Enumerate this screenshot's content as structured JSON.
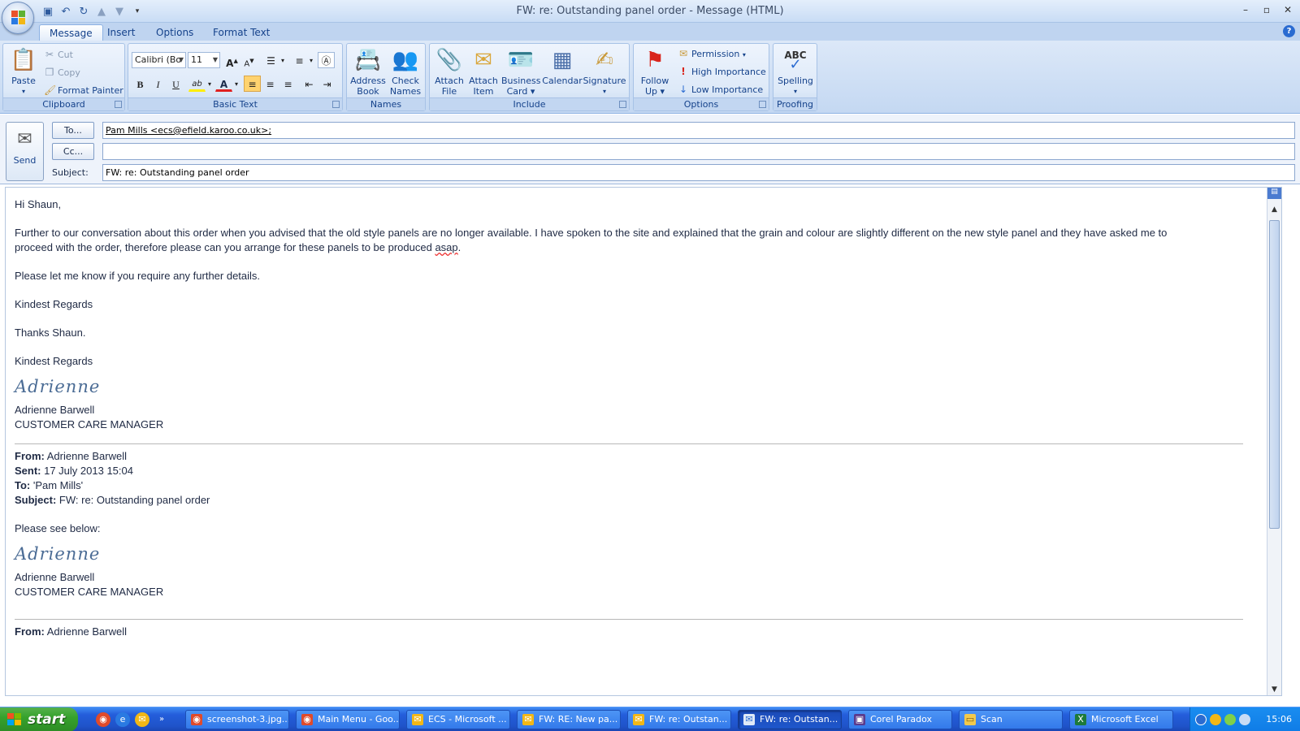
{
  "window": {
    "title": "FW: re: Outstanding panel order - Message (HTML)",
    "controls": [
      "–",
      "▫",
      "✕"
    ]
  },
  "ribbon_tabs": [
    "Message",
    "Insert",
    "Options",
    "Format Text"
  ],
  "ribbon": {
    "clipboard": {
      "label": "Clipboard",
      "paste": "Paste",
      "cut": "Cut",
      "copy": "Copy",
      "format_painter": "Format Painter"
    },
    "basic_text": {
      "label": "Basic Text",
      "font": "Calibri (Bo",
      "size": "11",
      "bold": "B",
      "italic": "I",
      "underline": "U"
    },
    "names": {
      "label": "Names",
      "address_book": [
        "Address",
        "Book"
      ],
      "check_names": [
        "Check",
        "Names"
      ]
    },
    "include": {
      "label": "Include",
      "attach_file": [
        "Attach",
        "File"
      ],
      "attach_item": [
        "Attach",
        "Item"
      ],
      "business_card": [
        "Business",
        "Card ▾"
      ],
      "calendar": "Calendar",
      "signature": "Signature"
    },
    "options": {
      "label": "Options",
      "follow_up": [
        "Follow",
        "Up ▾"
      ],
      "permission": "Permission",
      "high_importance": "High Importance",
      "low_importance": "Low Importance"
    },
    "proofing": {
      "label": "Proofing",
      "spelling": "Spelling",
      "abc": "ABC"
    }
  },
  "header": {
    "send": "Send",
    "to_button": "To...",
    "cc_button": "Cc...",
    "subject_label": "Subject:",
    "to_value": "Pam Mills <ecs@efield.karoo.co.uk>",
    "to_suffix": ";",
    "cc_value": "",
    "subject_value": "FW: re: Outstanding panel order"
  },
  "message": {
    "greeting": "Hi Shaun,",
    "para1_line1": "Further to our conversation about this order when you advised that the old style panels are no longer available.  I have spoken to the site and explained that the grain and colour are slightly different on the new style panel and they have asked me to",
    "para1_line2_pre": "proceed with the order, therefore please can you arrange for these panels to be produced ",
    "para1_asap": "asap",
    "para1_end": ".",
    "para2": "Please let me know if you require any further details.",
    "regards1": "Kindest Regards",
    "thanks": "Thanks Shaun.",
    "regards2": "Kindest Regards",
    "sig_script": "Adrienne",
    "sig_name": "Adrienne Barwell",
    "sig_title": "CUSTOMER CARE MANAGER",
    "fwd": {
      "from_label": "From:",
      "from": " Adrienne Barwell",
      "sent_label": "Sent:",
      "sent": " 17 July 2013 15:04",
      "to_label": "To:",
      "to": " 'Pam Mills'",
      "subject_label": "Subject:",
      "subject": " FW: re: Outstanding panel order"
    },
    "see_below": "Please see below:",
    "sig2_script": "Adrienne",
    "sig2_name": "Adrienne Barwell",
    "sig2_title": "CUSTOMER CARE MANAGER",
    "fwd2_from_label": "From:",
    "fwd2_from": " Adrienne Barwell"
  },
  "taskbar": {
    "start": "start",
    "tasks": [
      "screenshot-3.jpg...",
      "Main Menu - Goo...",
      "ECS - Microsoft ...",
      "FW: RE: New pa...",
      "FW: re: Outstan...",
      "FW: re: Outstan...",
      "Corel Paradox",
      "Scan",
      "Microsoft Excel"
    ],
    "clock": "15:06"
  }
}
